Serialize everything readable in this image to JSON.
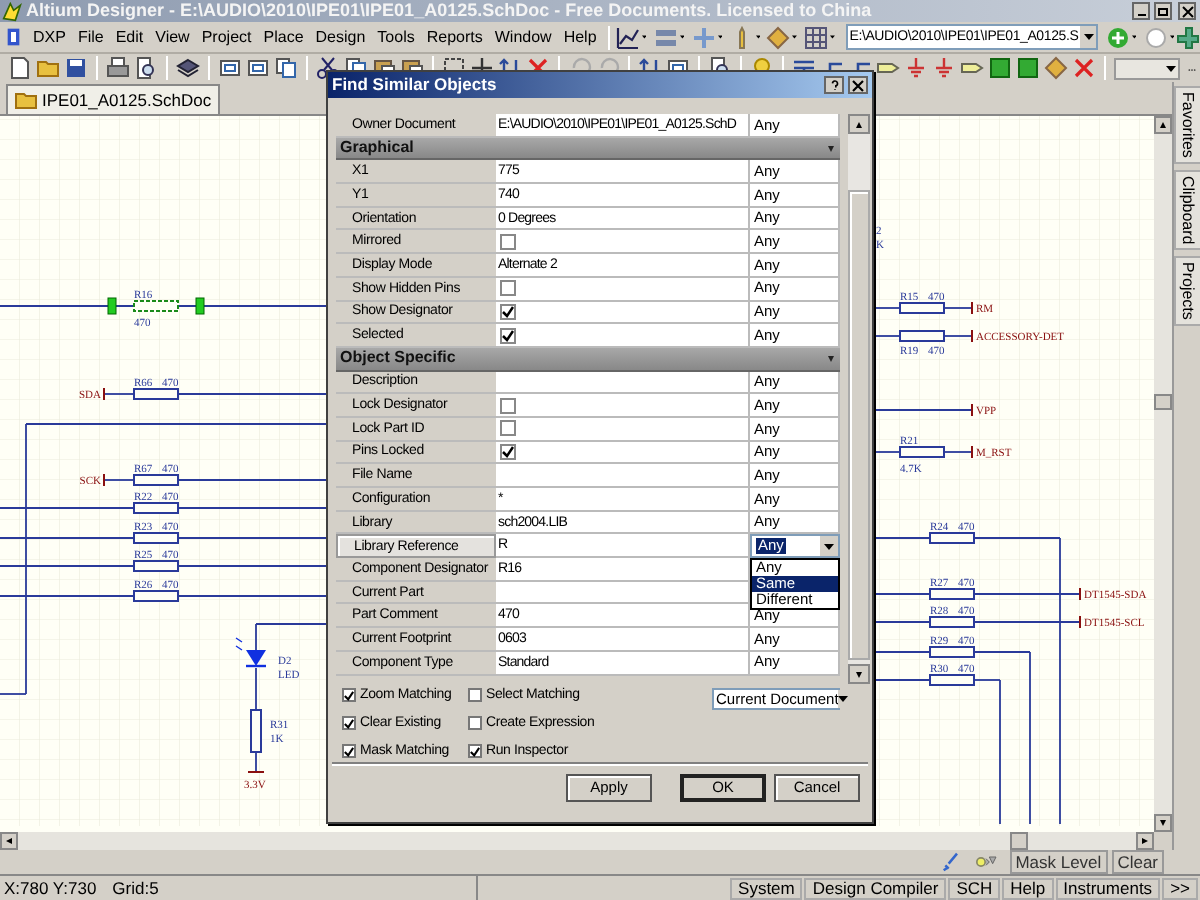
{
  "window": {
    "title": "Altium Designer - E:\\AUDIO\\2010\\IPE01\\IPE01_A0125.SchDoc - Free Documents. Licensed to China"
  },
  "menu": [
    "DXP",
    "File",
    "Edit",
    "View",
    "Project",
    "Place",
    "Design",
    "Tools",
    "Reports",
    "Window",
    "Help"
  ],
  "document_path": "E:\\AUDIO\\2010\\IPE01\\IPE01_A0125.S",
  "document_tabs": [
    {
      "label": "IPE01_A0125.SchDoc",
      "selected": true
    }
  ],
  "side_panel_tabs": [
    "Favorites",
    "Clipboard",
    "Projects"
  ],
  "schematic": {
    "components": [
      {
        "kind": "resistor",
        "designator": "R16",
        "value": "470",
        "selected": true
      },
      {
        "kind": "resistor",
        "designator": "R66",
        "value": "470",
        "selected": false
      },
      {
        "kind": "resistor",
        "designator": "R67",
        "value": "470",
        "selected": false
      },
      {
        "kind": "resistor",
        "designator": "R22",
        "value": "470",
        "selected": false
      },
      {
        "kind": "resistor",
        "designator": "R23",
        "value": "470",
        "selected": false
      },
      {
        "kind": "resistor",
        "designator": "R25",
        "value": "470",
        "selected": false
      },
      {
        "kind": "resistor",
        "designator": "R26",
        "value": "470",
        "selected": false
      },
      {
        "kind": "led",
        "designator": "D2",
        "value": "LED",
        "selected": false
      },
      {
        "kind": "resistor",
        "designator": "R31",
        "value": "1K",
        "selected": false
      },
      {
        "kind": "resistor",
        "designator": "R15",
        "value": "470",
        "selected": false
      },
      {
        "kind": "resistor",
        "designator": "R19",
        "value": "470",
        "selected": false
      },
      {
        "kind": "resistor",
        "designator": "R21",
        "value": "4.7K",
        "selected": false
      },
      {
        "kind": "resistor",
        "designator": "R24",
        "value": "470",
        "selected": false
      },
      {
        "kind": "resistor",
        "designator": "R27",
        "value": "470",
        "selected": false
      },
      {
        "kind": "resistor",
        "designator": "R28",
        "value": "470",
        "selected": false
      },
      {
        "kind": "resistor",
        "designator": "R29",
        "value": "470",
        "selected": false
      },
      {
        "kind": "resistor",
        "designator": "R30",
        "value": "470",
        "selected": false
      },
      {
        "kind": "fragment",
        "designator": "2",
        "value": "K",
        "selected": false
      }
    ],
    "net_labels": [
      {
        "kind": "net",
        "label": "SDA"
      },
      {
        "kind": "net",
        "label": "SCK"
      },
      {
        "kind": "power",
        "label": "3.3V"
      },
      {
        "kind": "net",
        "label": "RM"
      },
      {
        "kind": "net",
        "label": "ACCESSORY-DET"
      },
      {
        "kind": "net",
        "label": "VPP"
      },
      {
        "kind": "net",
        "label": "M_RST"
      },
      {
        "kind": "net",
        "label": "DT1545-SDA"
      },
      {
        "kind": "net",
        "label": "DT1545-SCL"
      }
    ]
  },
  "dialog": {
    "title": "Find Similar Objects",
    "rows": [
      {
        "kind": "text",
        "label": "Owner Document",
        "value": "E:\\AUDIO\\2010\\IPE01\\IPE01_A0125.SchD",
        "match": "Any",
        "selected": false
      },
      {
        "kind": "section",
        "label": "Graphical"
      },
      {
        "kind": "text",
        "label": "X1",
        "value": "775",
        "match": "Any",
        "selected": false
      },
      {
        "kind": "text",
        "label": "Y1",
        "value": "740",
        "match": "Any",
        "selected": false
      },
      {
        "kind": "text",
        "label": "Orientation",
        "value": "0 Degrees",
        "match": "Any",
        "selected": false
      },
      {
        "kind": "checkbox",
        "label": "Mirrored",
        "checked": false,
        "match": "Any",
        "selected": false
      },
      {
        "kind": "text",
        "label": "Display Mode",
        "value": "Alternate 2",
        "match": "Any",
        "selected": false
      },
      {
        "kind": "checkbox",
        "label": "Show Hidden Pins",
        "checked": false,
        "match": "Any",
        "selected": false
      },
      {
        "kind": "checkbox",
        "label": "Show Designator",
        "checked": true,
        "match": "Any",
        "selected": false
      },
      {
        "kind": "checkbox",
        "label": "Selected",
        "checked": true,
        "match": "Any",
        "selected": false
      },
      {
        "kind": "section",
        "label": "Object Specific"
      },
      {
        "kind": "text",
        "label": "Description",
        "value": "",
        "match": "Any",
        "selected": false
      },
      {
        "kind": "checkbox",
        "label": "Lock Designator",
        "checked": false,
        "match": "Any",
        "selected": false
      },
      {
        "kind": "checkbox",
        "label": "Lock Part ID",
        "checked": false,
        "match": "Any",
        "selected": false
      },
      {
        "kind": "checkbox",
        "label": "Pins Locked",
        "checked": true,
        "match": "Any",
        "selected": false
      },
      {
        "kind": "text",
        "label": "File Name",
        "value": "",
        "match": "Any",
        "selected": false
      },
      {
        "kind": "text",
        "label": "Configuration",
        "value": "*",
        "match": "Any",
        "selected": false
      },
      {
        "kind": "text",
        "label": "Library",
        "value": "sch2004.LIB",
        "match": "Any",
        "selected": false
      },
      {
        "kind": "text",
        "label": "Library Reference",
        "value": "R",
        "match": "Any",
        "selected": true,
        "match_options": [
          {
            "label": "Any",
            "selected": false
          },
          {
            "label": "Same",
            "selected": true
          },
          {
            "label": "Different",
            "selected": false
          }
        ]
      },
      {
        "kind": "text",
        "label": "Component Designator",
        "value": "R16",
        "match": "",
        "selected": false
      },
      {
        "kind": "text",
        "label": "Current Part",
        "value": "",
        "match": "",
        "selected": false
      },
      {
        "kind": "text",
        "label": "Part Comment",
        "value": "470",
        "match": "Any",
        "selected": false
      },
      {
        "kind": "text",
        "label": "Current Footprint",
        "value": "0603",
        "match": "Any",
        "selected": false
      },
      {
        "kind": "text",
        "label": "Component Type",
        "value": "Standard",
        "match": "Any",
        "selected": false
      }
    ],
    "options": [
      {
        "label": "Zoom Matching",
        "checked": true
      },
      {
        "label": "Select Matching",
        "checked": false
      },
      {
        "label": "Clear Existing",
        "checked": true
      },
      {
        "label": "Create Expression",
        "checked": false
      },
      {
        "label": "Mask Matching",
        "checked": true
      },
      {
        "label": "Run Inspector",
        "checked": true
      }
    ],
    "scope": "Current Document",
    "buttons": [
      {
        "label": "Apply",
        "default": false
      },
      {
        "label": "OK",
        "default": true
      },
      {
        "label": "Cancel",
        "default": false
      }
    ]
  },
  "mask_bar": [
    "Mask Level",
    "Clear"
  ],
  "status_bar": {
    "cursor": "X:780 Y:730",
    "grid": "Grid:5",
    "panels": [
      "System",
      "Design Compiler",
      "SCH",
      "Help",
      "Instruments",
      ">>"
    ]
  }
}
